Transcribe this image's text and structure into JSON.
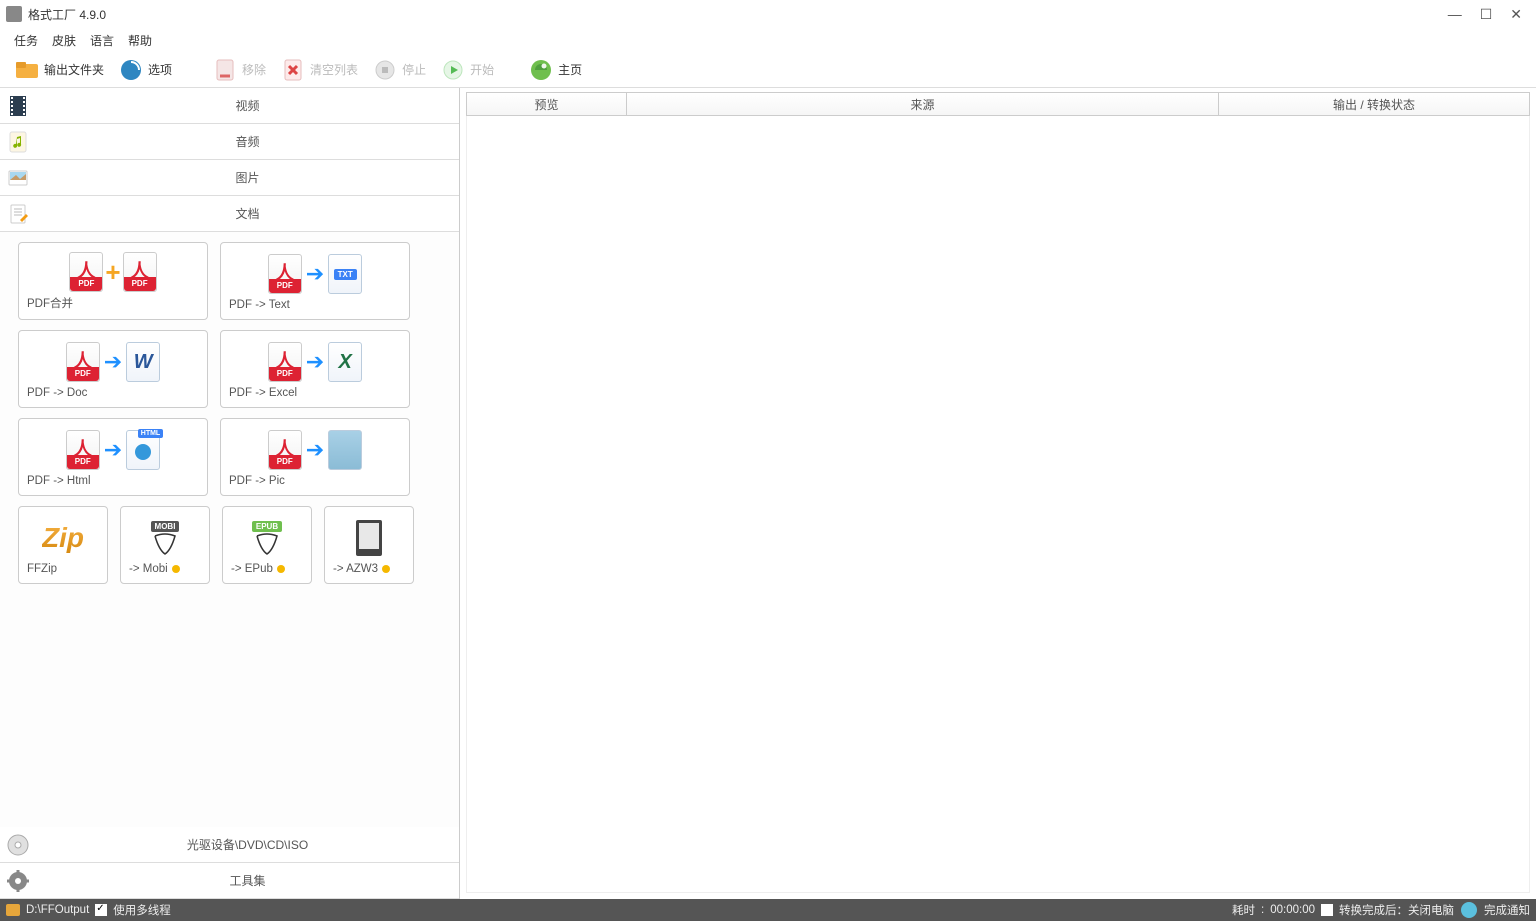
{
  "app": {
    "title": "格式工厂 4.9.0"
  },
  "menu": {
    "task": "任务",
    "skin": "皮肤",
    "lang": "语言",
    "help": "帮助"
  },
  "toolbar": {
    "output_folder": "输出文件夹",
    "options": "选项",
    "remove": "移除",
    "clear": "清空列表",
    "stop": "停止",
    "start": "开始",
    "home": "主页"
  },
  "categories": {
    "video": "视频",
    "audio": "音频",
    "picture": "图片",
    "document": "文档",
    "rom": "光驱设备\\DVD\\CD\\ISO",
    "tools": "工具集"
  },
  "tiles": {
    "pdf_merge": "PDF合并",
    "pdf_text": "PDF -> Text",
    "pdf_doc": "PDF -> Doc",
    "pdf_excel": "PDF -> Excel",
    "pdf_html": "PDF -> Html",
    "pdf_pic": "PDF -> Pic",
    "ffzip": "FFZip",
    "mobi": "-> Mobi",
    "epub": "-> EPub",
    "azw3": "-> AZW3"
  },
  "columns": {
    "preview": "预览",
    "source": "来源",
    "status": "输出 / 转换状态"
  },
  "status": {
    "output_path": "D:\\FFOutput",
    "multithread": "使用多线程",
    "elapsed_label": "耗时",
    "elapsed_value": "00:00:00",
    "after_convert": "转换完成后：关闭电脑",
    "notify": "完成通知"
  }
}
